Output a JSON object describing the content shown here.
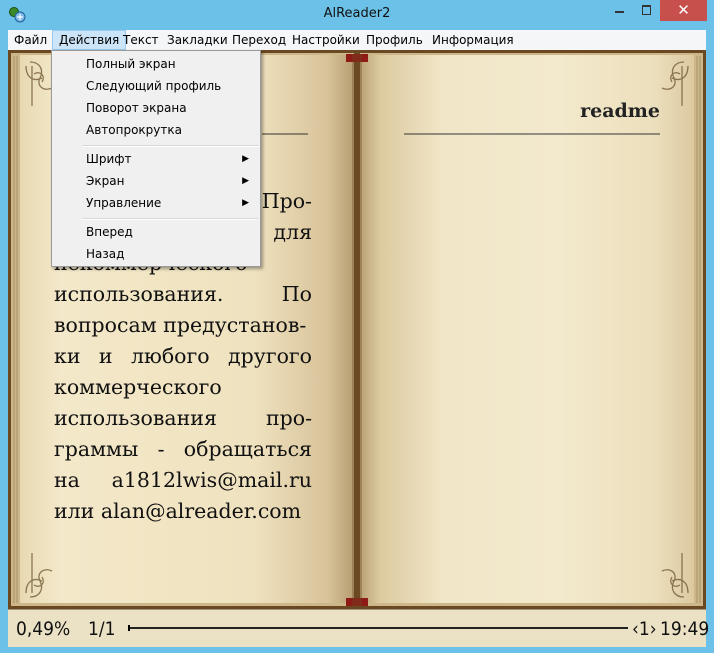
{
  "window": {
    "title": "AlReader2",
    "close_glyph": "✕",
    "icon": "alreader-app-icon"
  },
  "menubar": {
    "items": [
      "Файл",
      "Действия",
      "Текст",
      "Закладки",
      "Переход",
      "Настройки",
      "Профиль",
      "Информация"
    ],
    "active": "Действия"
  },
  "dropdown": {
    "group1": [
      "Полный экран",
      "Следующий профиль",
      "Поворот экрана",
      "Автопрокрутка"
    ],
    "group2": [
      "Шрифт",
      "Экран",
      "Управление"
    ],
    "group3": [
      "Вперед",
      "Назад"
    ],
    "submenu_arrow": "▶"
  },
  "book": {
    "header_right": "readme",
    "left_page_lines": [
      [
        "Про-"
      ],
      [
        "для"
      ],
      [
        "некоммерческого"
      ],
      [
        "использования.",
        "По"
      ],
      [
        "вопросам предустанов-"
      ],
      [
        "ки",
        "и",
        "любого",
        "другого"
      ],
      [
        "коммерческого"
      ],
      [
        "использования",
        "про-"
      ],
      [
        "граммы",
        "-",
        "обращаться"
      ],
      [
        "на",
        "a1812lwis@mail.ru"
      ],
      [
        "или alan@alreader.com"
      ]
    ],
    "colors": {
      "paper": "#f2e6c6",
      "cover": "#6b4a22",
      "spine_red": "#9a1f1a"
    }
  },
  "statusbar": {
    "percent": "0,49%",
    "pages": "1/1",
    "page_marker": "‹1›",
    "time": "19:49",
    "progress_fraction": 0.0049
  }
}
